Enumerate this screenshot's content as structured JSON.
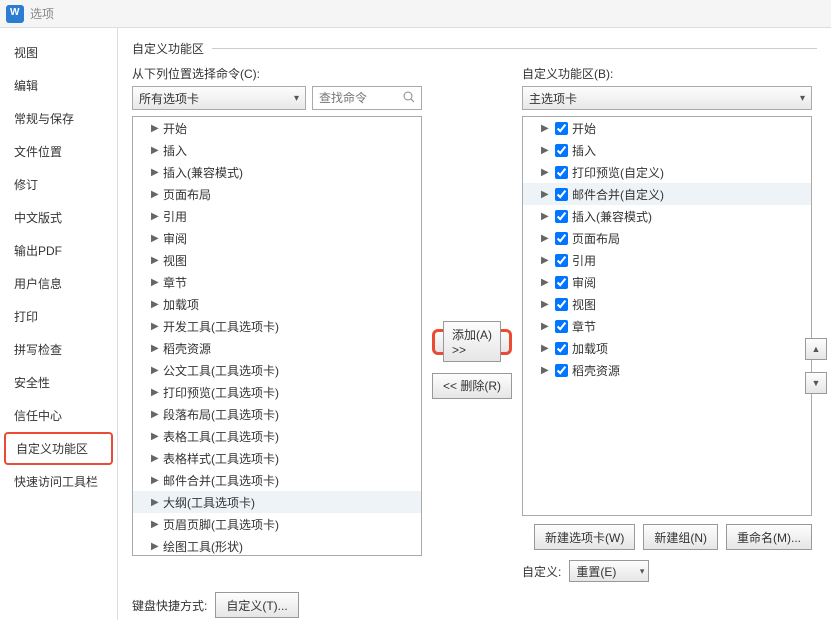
{
  "window": {
    "title": "选项"
  },
  "sidebar": {
    "items": [
      "视图",
      "编辑",
      "常规与保存",
      "文件位置",
      "修订",
      "中文版式",
      "输出PDF",
      "用户信息",
      "打印",
      "拼写检查",
      "安全性",
      "信任中心",
      "自定义功能区",
      "快速访问工具栏"
    ],
    "activeIndex": 12
  },
  "section": {
    "title": "自定义功能区"
  },
  "left": {
    "label": "从下列位置选择命令(C):",
    "dropdown": "所有选项卡",
    "search_placeholder": "查找命令",
    "items": [
      "开始",
      "插入",
      "插入(兼容模式)",
      "页面布局",
      "引用",
      "审阅",
      "视图",
      "章节",
      "加载项",
      "开发工具(工具选项卡)",
      "稻壳资源",
      "公文工具(工具选项卡)",
      "打印预览(工具选项卡)",
      "段落布局(工具选项卡)",
      "表格工具(工具选项卡)",
      "表格样式(工具选项卡)",
      "邮件合并(工具选项卡)",
      "大纲(工具选项卡)",
      "页眉页脚(工具选项卡)",
      "绘图工具(形状)"
    ],
    "selectedIndex": 17
  },
  "mid": {
    "add": "添加(A) >>",
    "remove": "<< 删除(R)"
  },
  "right": {
    "label": "自定义功能区(B):",
    "dropdown": "主选项卡",
    "items": [
      "开始",
      "插入",
      "打印预览(自定义)",
      "邮件合并(自定义)",
      "插入(兼容模式)",
      "页面布局",
      "引用",
      "审阅",
      "视图",
      "章节",
      "加载项",
      "稻壳资源"
    ],
    "selectedIndex": 3
  },
  "rightButtons": {
    "newTab": "新建选项卡(W)",
    "newGroup": "新建组(N)",
    "rename": "重命名(M)..."
  },
  "bottom": {
    "shortcutLabel": "键盘快捷方式:",
    "customBtn": "自定义(T)...",
    "customLabel": "自定义:",
    "resetDrop": "重置(E)"
  }
}
